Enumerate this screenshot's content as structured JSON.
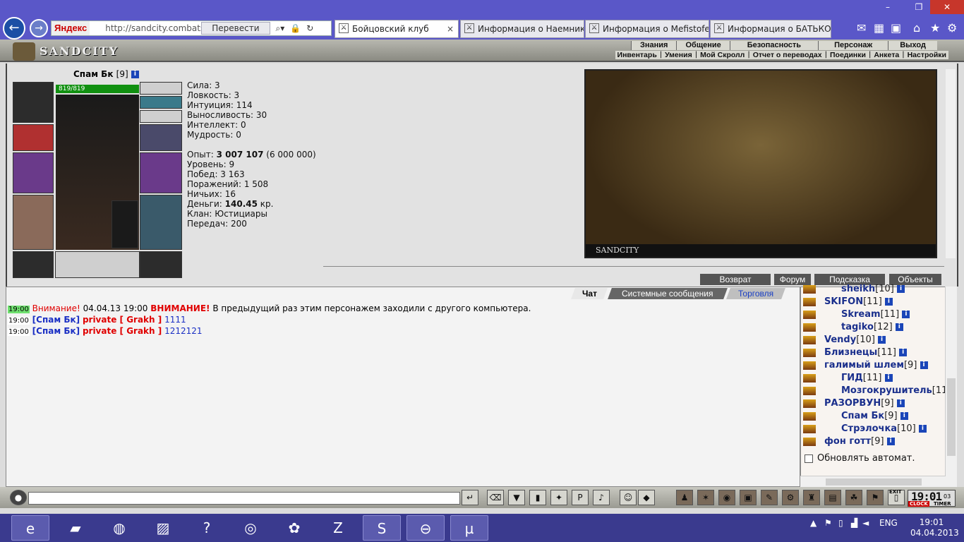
{
  "browser": {
    "back_icon": "back-arrow-icon",
    "yandex_label": "Яндекс",
    "address_url": "http://sandcity.combats.co",
    "translate_label": "Перевести",
    "tabs": [
      {
        "label": "Бойцовский клуб",
        "active": true
      },
      {
        "label": "Информация о Наемник..."
      },
      {
        "label": "Информация о Mefistofe..."
      },
      {
        "label": "Информация о БАТЬКО Я"
      }
    ]
  },
  "game": {
    "logo_text": "SANDCITY",
    "menu_top": [
      "Знания",
      "Общение",
      "Безопасность",
      "Персонаж",
      "Выход"
    ],
    "menu_sub": [
      "Инвентарь",
      "Умения",
      "Мой Скролл",
      "Отчет о переводах",
      "Поединки",
      "Анкета",
      "Настройки"
    ],
    "character": {
      "name": "Спам Бк",
      "level": "[9]",
      "hp": "819/819"
    },
    "stats": {
      "strength": "Сила: 3",
      "agility": "Ловкость: 3",
      "intuition": "Интуиция: 114",
      "endurance": "Выносливость: 30",
      "intellect": "Интеллект: 0",
      "wisdom": "Мудрость: 0",
      "exp_label": "Опыт:",
      "exp_value": "3 007 107",
      "exp_next": "(6 000 000)",
      "level": "Уровень: 9",
      "wins": "Побед: 3 163",
      "losses": "Поражений: 1 508",
      "draws": "Ничьих: 16",
      "money_label": "Деньги:",
      "money_value": "140.45",
      "money_unit": "кр.",
      "clan": "Клан: Юстициары",
      "transfers": "Передач: 200"
    },
    "scene_brand": "SANDCITY",
    "bottom_buttons": [
      "Возврат",
      "Форум",
      "Подсказка",
      "Объекты"
    ],
    "chat_tabs": [
      "Чат",
      "Системные сообщения",
      "Торговля"
    ],
    "messages": [
      {
        "time": "19:00",
        "warn": "Внимание!",
        "date": "04.04.13 19:00",
        "caps": "ВНИМАНИЕ!",
        "text": "В предыдущий раз этим персонажем заходили с другого компьютера."
      },
      {
        "time": "19:00",
        "from": "[Спам Бк]",
        "private": "private [ Grakh ]",
        "text": "1111"
      },
      {
        "time": "19:00",
        "from": "[Спам Бк]",
        "private": "private [ Grakh ]",
        "text": "1212121"
      }
    ],
    "users": [
      {
        "name": "sheikh",
        "level": "[10]"
      },
      {
        "name": "SKIFON",
        "level": "[11]"
      },
      {
        "name": "Skream",
        "level": "[11]"
      },
      {
        "name": "tagiko",
        "level": "[12]"
      },
      {
        "name": "Vendy",
        "level": "[10]"
      },
      {
        "name": "Близнецы",
        "level": "[11]"
      },
      {
        "name": "галимый шлем",
        "level": "[9]"
      },
      {
        "name": "ГИД",
        "level": "[11]"
      },
      {
        "name": "Мозгокрушитель",
        "level": "[11"
      },
      {
        "name": "РАЗОРВУН",
        "level": "[9]"
      },
      {
        "name": "Спам Бк",
        "level": "[9]"
      },
      {
        "name": "Стрэлочка",
        "level": "[10]"
      },
      {
        "name": "фон готт",
        "level": "[9]"
      }
    ],
    "auto_refresh": "Обновлять автомат.",
    "clock": {
      "time": "19:01",
      "sec": "03",
      "label1": "CLOCK",
      "label2": "TIMER",
      "exit": "EXIT"
    }
  },
  "taskbar": {
    "tray_lang": "ENG",
    "time": "19:01",
    "date": "04.04.2013"
  }
}
